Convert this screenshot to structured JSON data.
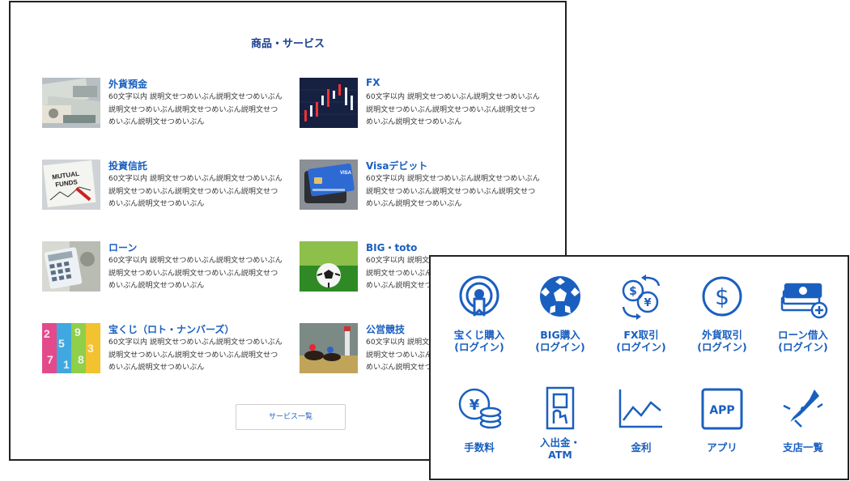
{
  "products": {
    "section_title": "商品・サービス",
    "items": [
      {
        "title": "外貨預金",
        "desc": "60文字以内 説明文せつめいぶん説明文せつめいぶん説明文せつめいぶん説明文せつめいぶん説明文せつめいぶん説明文せつめいぶん"
      },
      {
        "title": "FX",
        "desc": "60文字以内 説明文せつめいぶん説明文せつめいぶん説明文せつめいぶん説明文せつめいぶん説明文せつめいぶん説明文せつめいぶん"
      },
      {
        "title": "投資信託",
        "desc": "60文字以内 説明文せつめいぶん説明文せつめいぶん説明文せつめいぶん説明文せつめいぶん説明文せつめいぶん説明文せつめいぶん"
      },
      {
        "title": "Visaデビット",
        "desc": "60文字以内 説明文せつめいぶん説明文せつめいぶん説明文せつめいぶん説明文せつめいぶん説明文せつめいぶん説明文せつめいぶん"
      },
      {
        "title": "ローン",
        "desc": "60文字以内 説明文せつめいぶん説明文せつめいぶん説明文せつめいぶん説明文せつめいぶん説明文せつめいぶん説明文せつめいぶん"
      },
      {
        "title": "BIG・toto",
        "desc": "60文字以内 説明文せつめいぶん説明文せつめいぶん説明文せつめいぶん説明文せつめいぶん説明文せつめいぶん説明文せつめいぶん"
      },
      {
        "title": "宝くじ（ロト・ナンバーズ）",
        "desc": "60文字以内 説明文せつめいぶん説明文せつめいぶん説明文せつめいぶん説明文せつめいぶん説明文せつめいぶん説明文せつめいぶん"
      },
      {
        "title": "公営競技",
        "desc": "60文字以内 説明文せつめいぶん説明文せつめいぶん説明文せつめいぶん説明文せつめいぶん説明文せつめいぶん説明文せつめいぶん"
      }
    ],
    "all_button_label": "サービス一覧"
  },
  "quick_menu": {
    "tiles": [
      {
        "label": "宝くじ購入\n(ログイン)",
        "icon": "lottery-icon"
      },
      {
        "label": "BIG購入\n(ログイン)",
        "icon": "soccer-ball-icon"
      },
      {
        "label": "FX取引\n(ログイン)",
        "icon": "currency-exchange-icon"
      },
      {
        "label": "外貨取引\n(ログイン)",
        "icon": "dollar-coin-icon"
      },
      {
        "label": "ローン借入\n(ログイン)",
        "icon": "cash-stack-icon"
      },
      {
        "label": "手数料",
        "icon": "yen-coins-icon"
      },
      {
        "label": "入出金・\nATM",
        "icon": "atm-icon"
      },
      {
        "label": "金利",
        "icon": "line-chart-icon"
      },
      {
        "label": "アプリ",
        "icon": "app-icon"
      },
      {
        "label": "支店一覧",
        "icon": "branch-map-icon"
      }
    ],
    "accent_color": "#1a5fbf",
    "app_icon_text": "APP"
  }
}
